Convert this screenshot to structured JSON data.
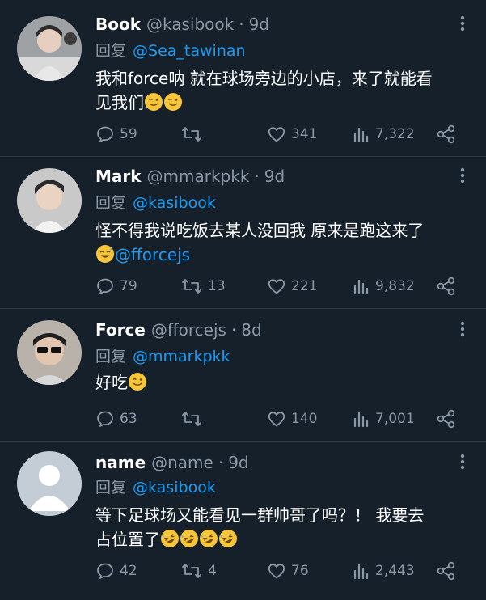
{
  "tweets": [
    {
      "author": "Book",
      "handle": "@kasibook",
      "time": "9d",
      "reply_prefix": "回复",
      "reply_to": "@Sea_tawinan",
      "text_line1": "我和force呐 就在球场旁边的小店，来了就能看",
      "text_line2": "见我们",
      "emoji": [
        "wink-face-emoji",
        "wink-face-emoji"
      ],
      "replies": "59",
      "retweets": "",
      "likes": "341",
      "views": "7,322"
    },
    {
      "author": "Mark",
      "handle": "@mmarkpkk",
      "time": "9d",
      "reply_prefix": "回复",
      "reply_to": "@kasibook",
      "text_line1": "怪不得我说吃饭去某人没回我 原来是跑这来了",
      "mention_in_text": "@fforcejs",
      "emoji": [
        "sweat-smile-emoji"
      ],
      "replies": "79",
      "retweets": "13",
      "likes": "221",
      "views": "9,832"
    },
    {
      "author": "Force",
      "handle": "@fforcejs",
      "time": "8d",
      "reply_prefix": "回复",
      "reply_to": "@mmarkpkk",
      "text_line1": "好吃",
      "emoji": [
        "wink-face-emoji"
      ],
      "replies": "63",
      "retweets": "",
      "likes": "140",
      "views": "7,001"
    },
    {
      "author": "name",
      "handle": "@name",
      "time": "9d",
      "reply_prefix": "回复",
      "reply_to": "@kasibook",
      "text_line1": "等下足球场又能看见一群帅哥了吗？！ 我要去",
      "text_line2": "占位置了",
      "emoji": [
        "rofl-emoji",
        "rofl-emoji",
        "rofl-emoji",
        "rofl-emoji"
      ],
      "replies": "42",
      "retweets": "4",
      "likes": "76",
      "views": "2,443"
    }
  ],
  "colors": {
    "background": "#15202b",
    "text": "#ffffff",
    "muted": "#8b98a5",
    "link": "#1d9bf0",
    "divider": "#2f3943"
  }
}
